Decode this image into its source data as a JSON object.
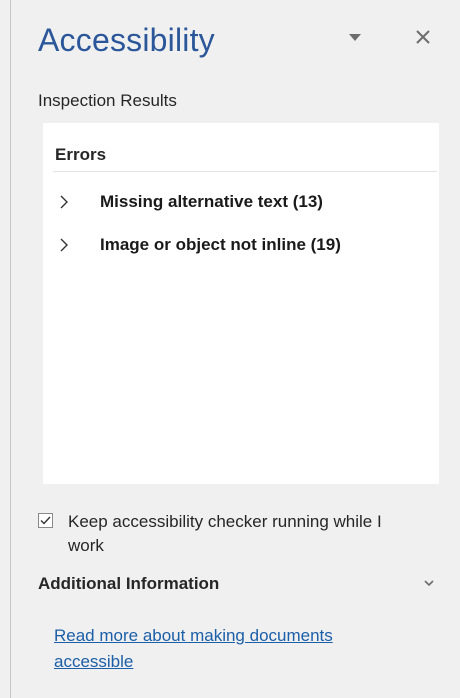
{
  "pane": {
    "title": "Accessibility",
    "menu_icon": "dropdown-triangle-icon",
    "close_icon": "close-icon"
  },
  "inspection": {
    "label": "Inspection Results"
  },
  "errors": {
    "heading": "Errors",
    "items": [
      {
        "label": "Missing alternative text (13)",
        "icon": "chevron-right-icon"
      },
      {
        "label": "Image or object not inline (19)",
        "icon": "chevron-right-icon"
      }
    ]
  },
  "settings": {
    "keep_running_checked": true,
    "keep_running_label": "Keep accessibility checker running while I work"
  },
  "additional_info": {
    "title": "Additional Information",
    "icon": "chevron-down-icon",
    "link_text": "Read more about making documents accessible"
  },
  "colors": {
    "title_blue": "#2b579a",
    "link_blue": "#1b5fa8",
    "pane_background": "#f0f0f0"
  }
}
